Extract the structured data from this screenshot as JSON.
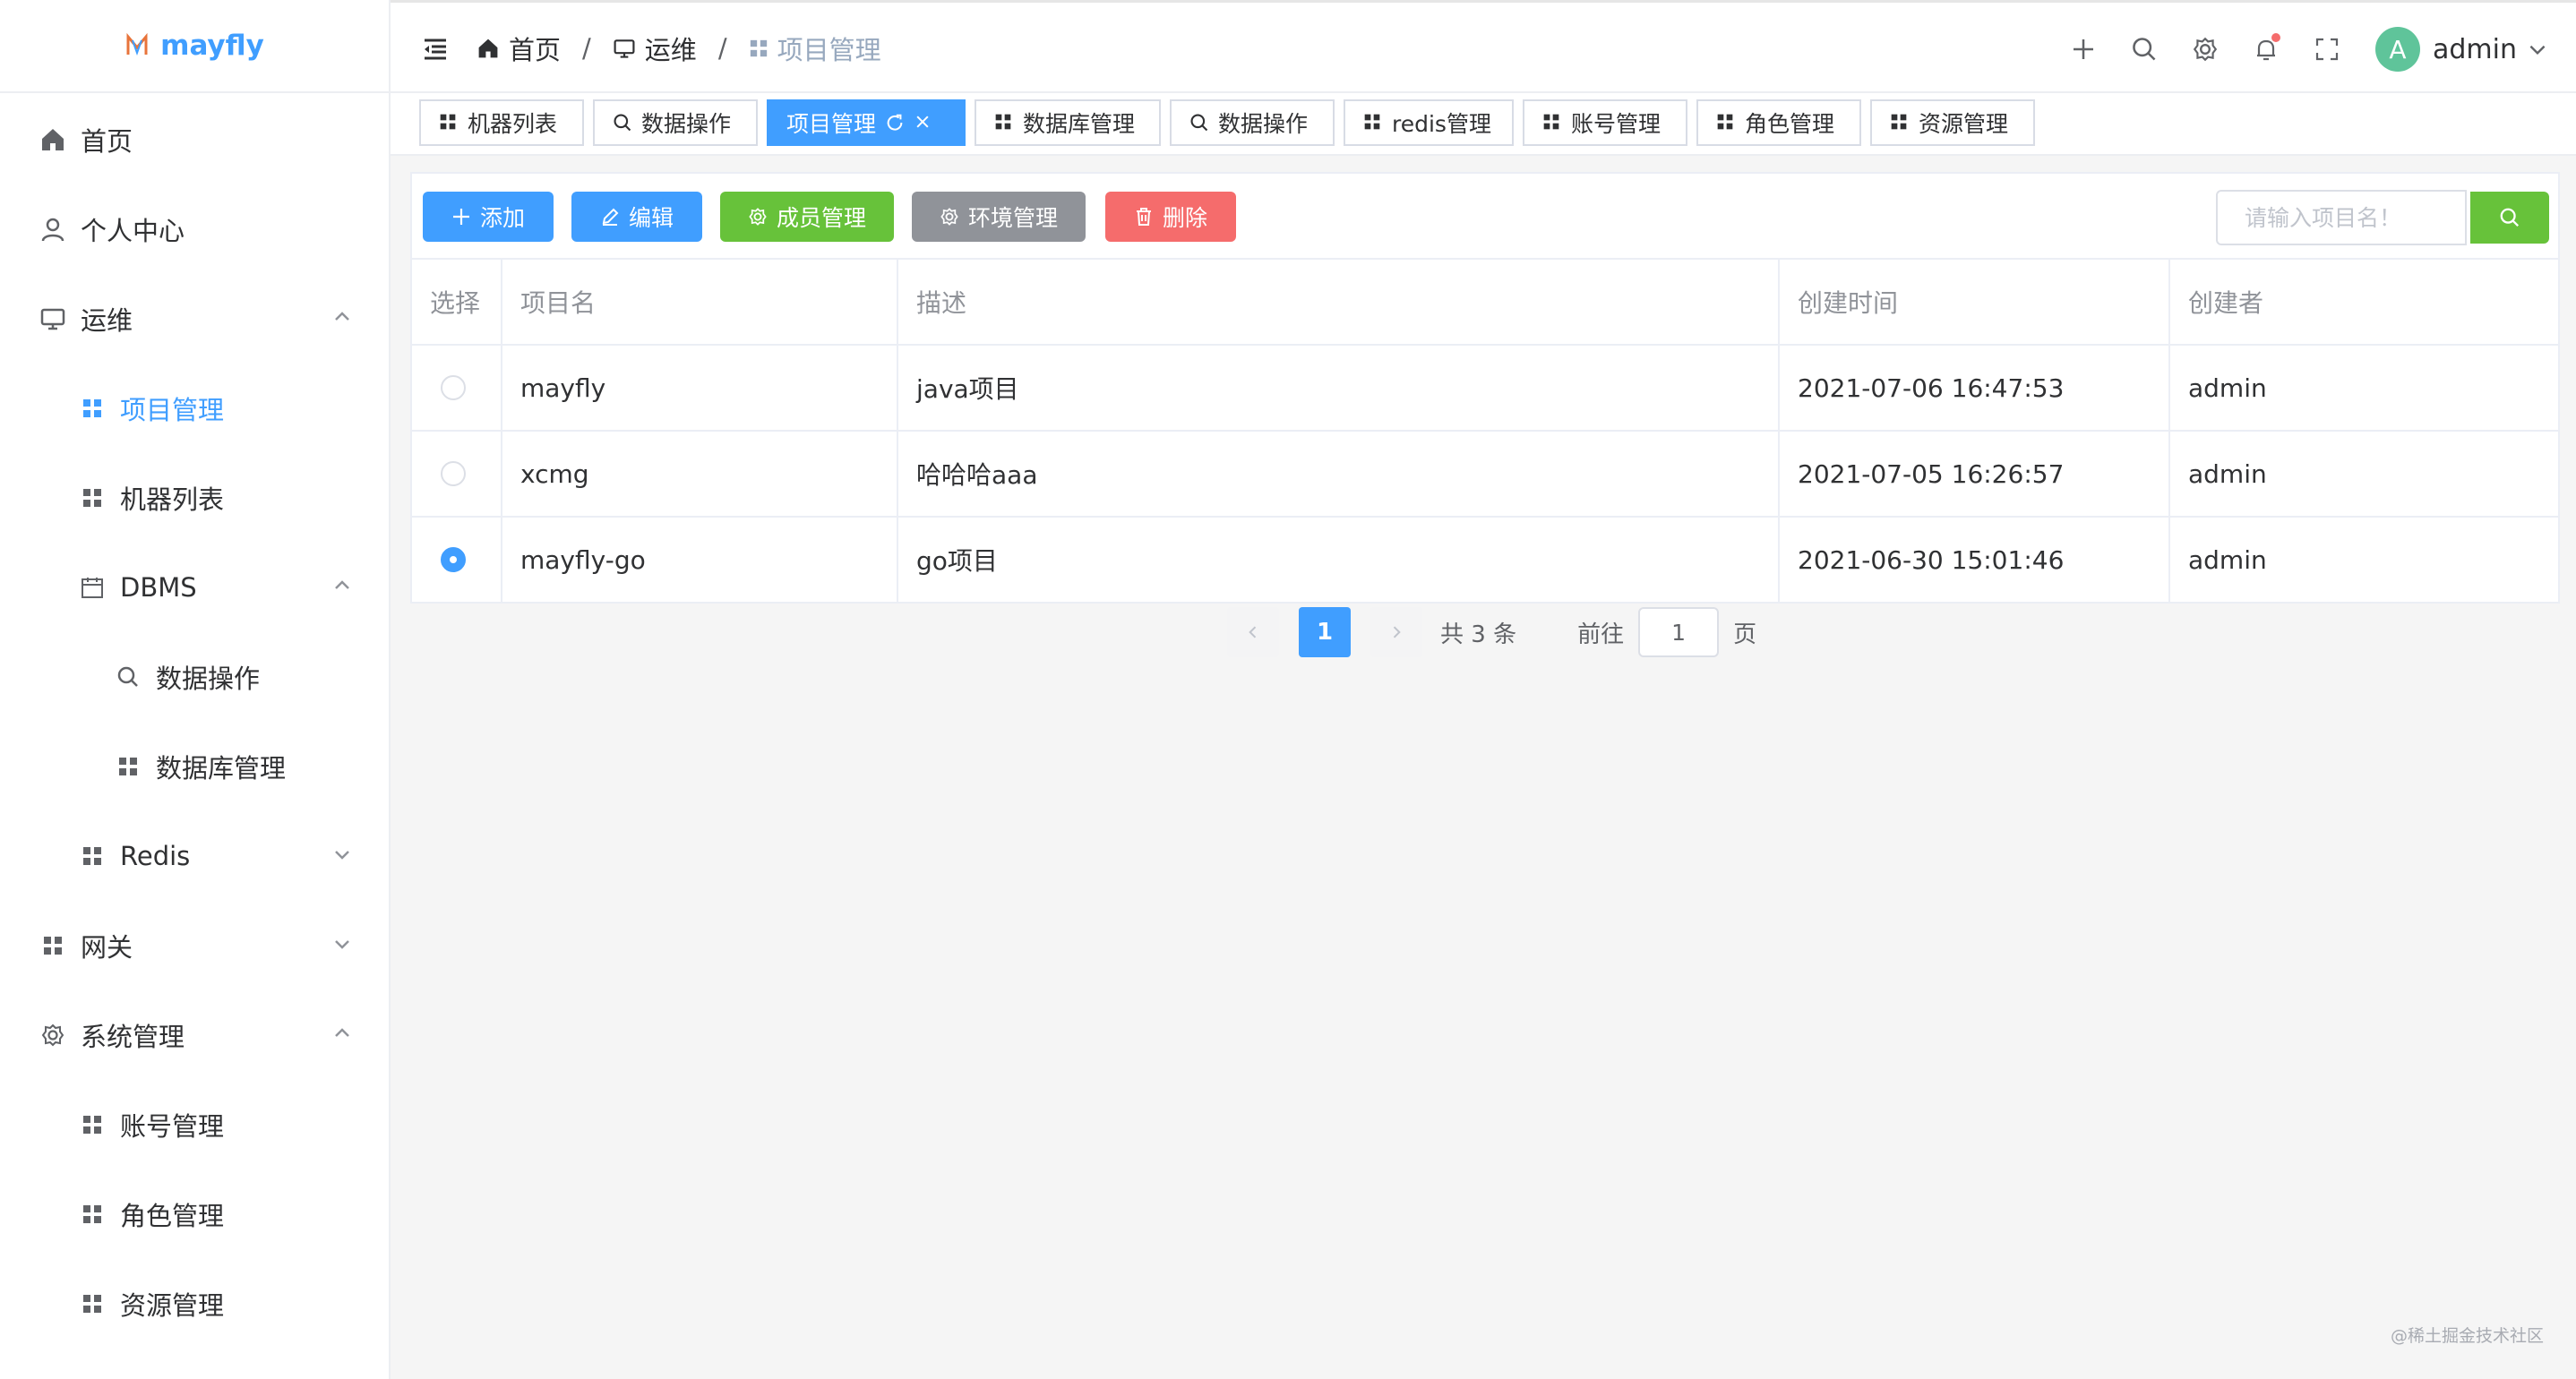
{
  "brand": {
    "name": "mayfly"
  },
  "sidebar": {
    "items": [
      {
        "label": "首页",
        "icon": "home-icon"
      },
      {
        "label": "个人中心",
        "icon": "user-icon"
      },
      {
        "label": "运维",
        "icon": "monitor-icon",
        "expanded": true
      },
      {
        "label": "项目管理",
        "icon": "grid-icon",
        "active": true
      },
      {
        "label": "机器列表",
        "icon": "grid-icon"
      },
      {
        "label": "DBMS",
        "icon": "calendar-icon",
        "expanded": true
      },
      {
        "label": "数据操作",
        "icon": "search-icon"
      },
      {
        "label": "数据库管理",
        "icon": "grid-icon"
      },
      {
        "label": "Redis",
        "icon": "grid-icon",
        "expanded": false
      },
      {
        "label": "网关",
        "icon": "grid-icon",
        "expanded": false
      },
      {
        "label": "系统管理",
        "icon": "gear-icon",
        "expanded": true
      },
      {
        "label": "账号管理",
        "icon": "grid-icon"
      },
      {
        "label": "角色管理",
        "icon": "grid-icon"
      },
      {
        "label": "资源管理",
        "icon": "grid-icon"
      }
    ]
  },
  "header": {
    "breadcrumb": [
      "首页",
      "运维",
      "项目管理"
    ],
    "user": {
      "avatar_letter": "A",
      "name": "admin"
    }
  },
  "tabs": [
    {
      "label": "机器列表",
      "icon": "grid-icon"
    },
    {
      "label": "数据操作",
      "icon": "search-icon"
    },
    {
      "label": "项目管理",
      "icon": "grid-icon",
      "active": true
    },
    {
      "label": "数据库管理",
      "icon": "grid-icon"
    },
    {
      "label": "数据操作",
      "icon": "search-icon"
    },
    {
      "label": "redis管理",
      "icon": "grid-icon"
    },
    {
      "label": "账号管理",
      "icon": "grid-icon"
    },
    {
      "label": "角色管理",
      "icon": "grid-icon"
    },
    {
      "label": "资源管理",
      "icon": "grid-icon"
    }
  ],
  "toolbar": {
    "add": "添加",
    "edit": "编辑",
    "members": "成员管理",
    "env": "环境管理",
    "delete": "删除",
    "search_placeholder": "请输入项目名！"
  },
  "table": {
    "columns": [
      "选择",
      "项目名",
      "描述",
      "创建时间",
      "创建者"
    ],
    "rows": [
      {
        "selected": false,
        "name": "mayfly",
        "desc": "java项目",
        "created": "2021-07-06 16:47:53",
        "creator": "admin"
      },
      {
        "selected": false,
        "name": "xcmg",
        "desc": "哈哈哈aaa",
        "created": "2021-07-05 16:26:57",
        "creator": "admin"
      },
      {
        "selected": true,
        "name": "mayfly-go",
        "desc": "go项目",
        "created": "2021-06-30 15:01:46",
        "creator": "admin"
      }
    ]
  },
  "pagination": {
    "current": "1",
    "total_text": "共 3 条",
    "goto_label": "前往",
    "goto_value": "1",
    "page_unit": "页"
  },
  "watermark": "@稀土掘金技术社区",
  "colors": {
    "primary": "#409eff",
    "success": "#67c23a",
    "info": "#909399",
    "danger": "#f56c6c",
    "avatar": "#5fc49a"
  }
}
